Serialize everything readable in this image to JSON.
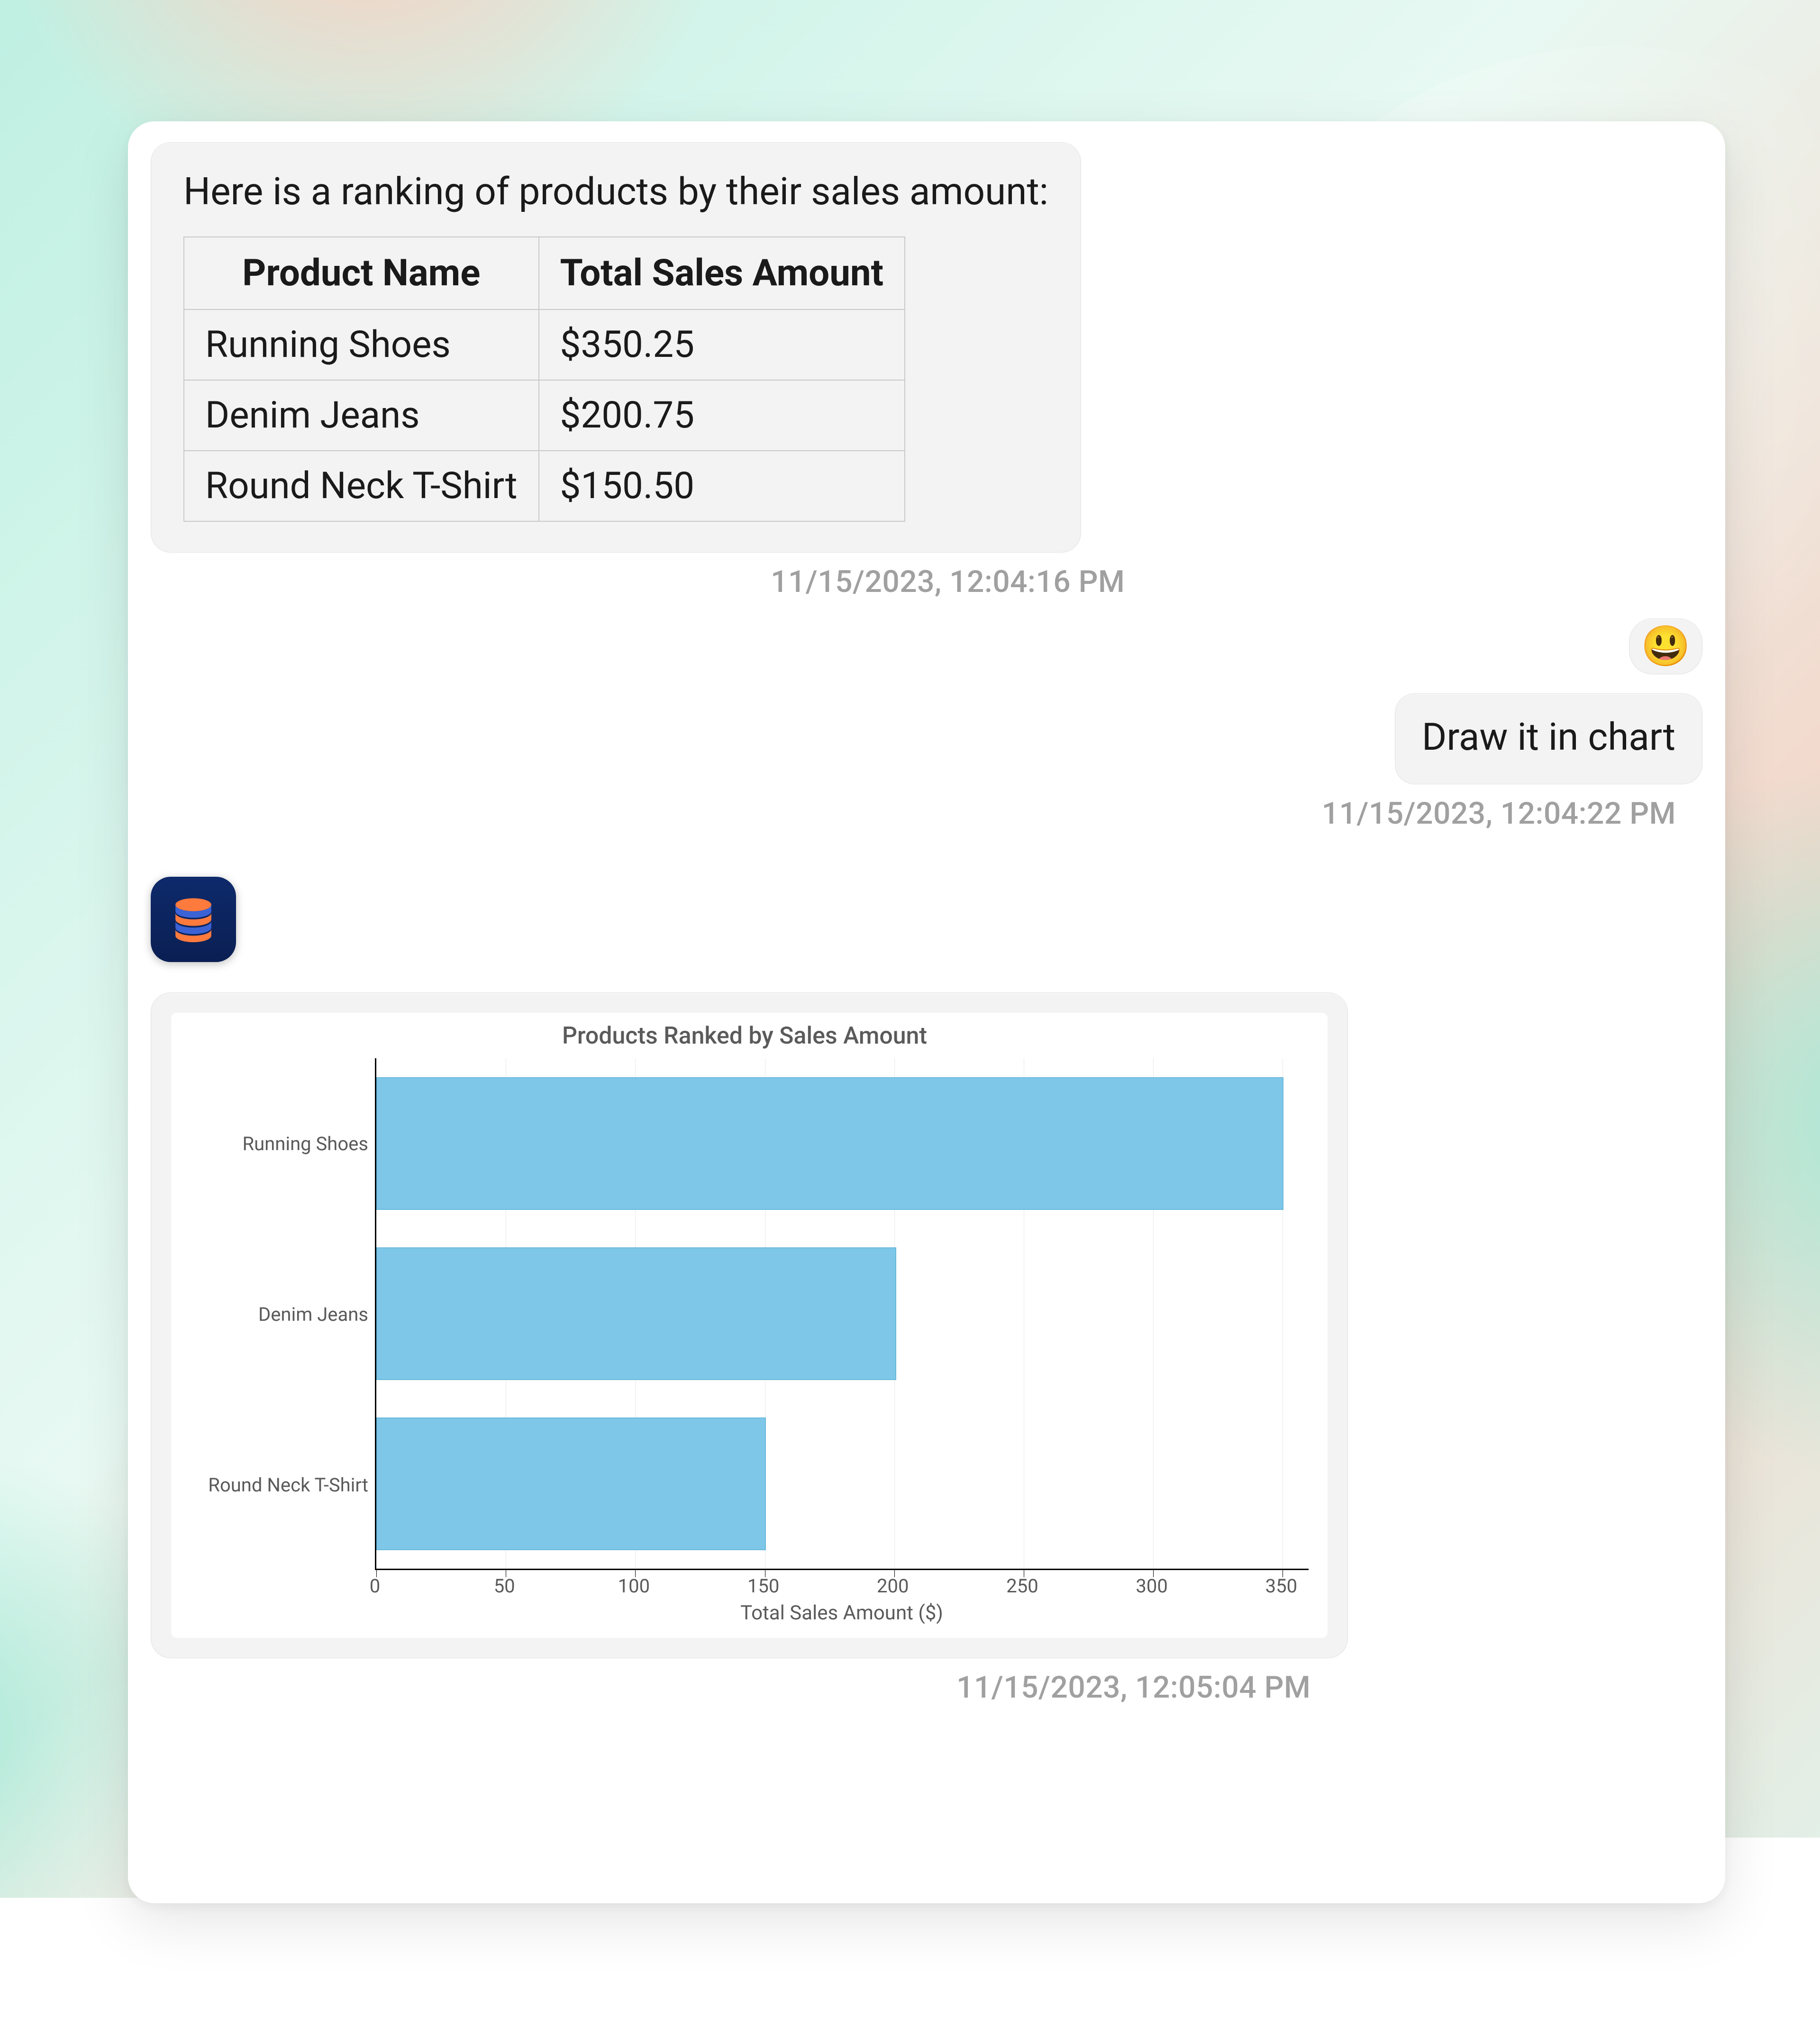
{
  "messages": {
    "m1": {
      "intro": "Here is a ranking of products by their sales amount:",
      "table": {
        "headers": {
          "c0": "Product Name",
          "c1": "Total Sales Amount"
        },
        "rows": [
          {
            "c0": "Running Shoes",
            "c1": "$350.25"
          },
          {
            "c0": "Denim Jeans",
            "c1": "$200.75"
          },
          {
            "c0": "Round Neck T-Shirt",
            "c1": "$150.50"
          }
        ]
      },
      "timestamp": "11/15/2023, 12:04:16 PM"
    },
    "m2": {
      "emoji": "😃",
      "text": "Draw it in chart",
      "timestamp": "11/15/2023, 12:04:22 PM"
    },
    "m3": {
      "timestamp": "11/15/2023, 12:05:04 PM"
    }
  },
  "chart_data": {
    "type": "bar",
    "orientation": "horizontal",
    "title": "Products Ranked by Sales Amount",
    "xlabel": "Total Sales Amount ($)",
    "ylabel": "",
    "categories": [
      "Running Shoes",
      "Denim Jeans",
      "Round Neck T-Shirt"
    ],
    "values": [
      350.25,
      200.75,
      150.5
    ],
    "xticks": [
      0,
      50,
      100,
      150,
      200,
      250,
      300,
      350
    ],
    "xlim": [
      0,
      360
    ],
    "bar_color": "#7ec7e8"
  }
}
